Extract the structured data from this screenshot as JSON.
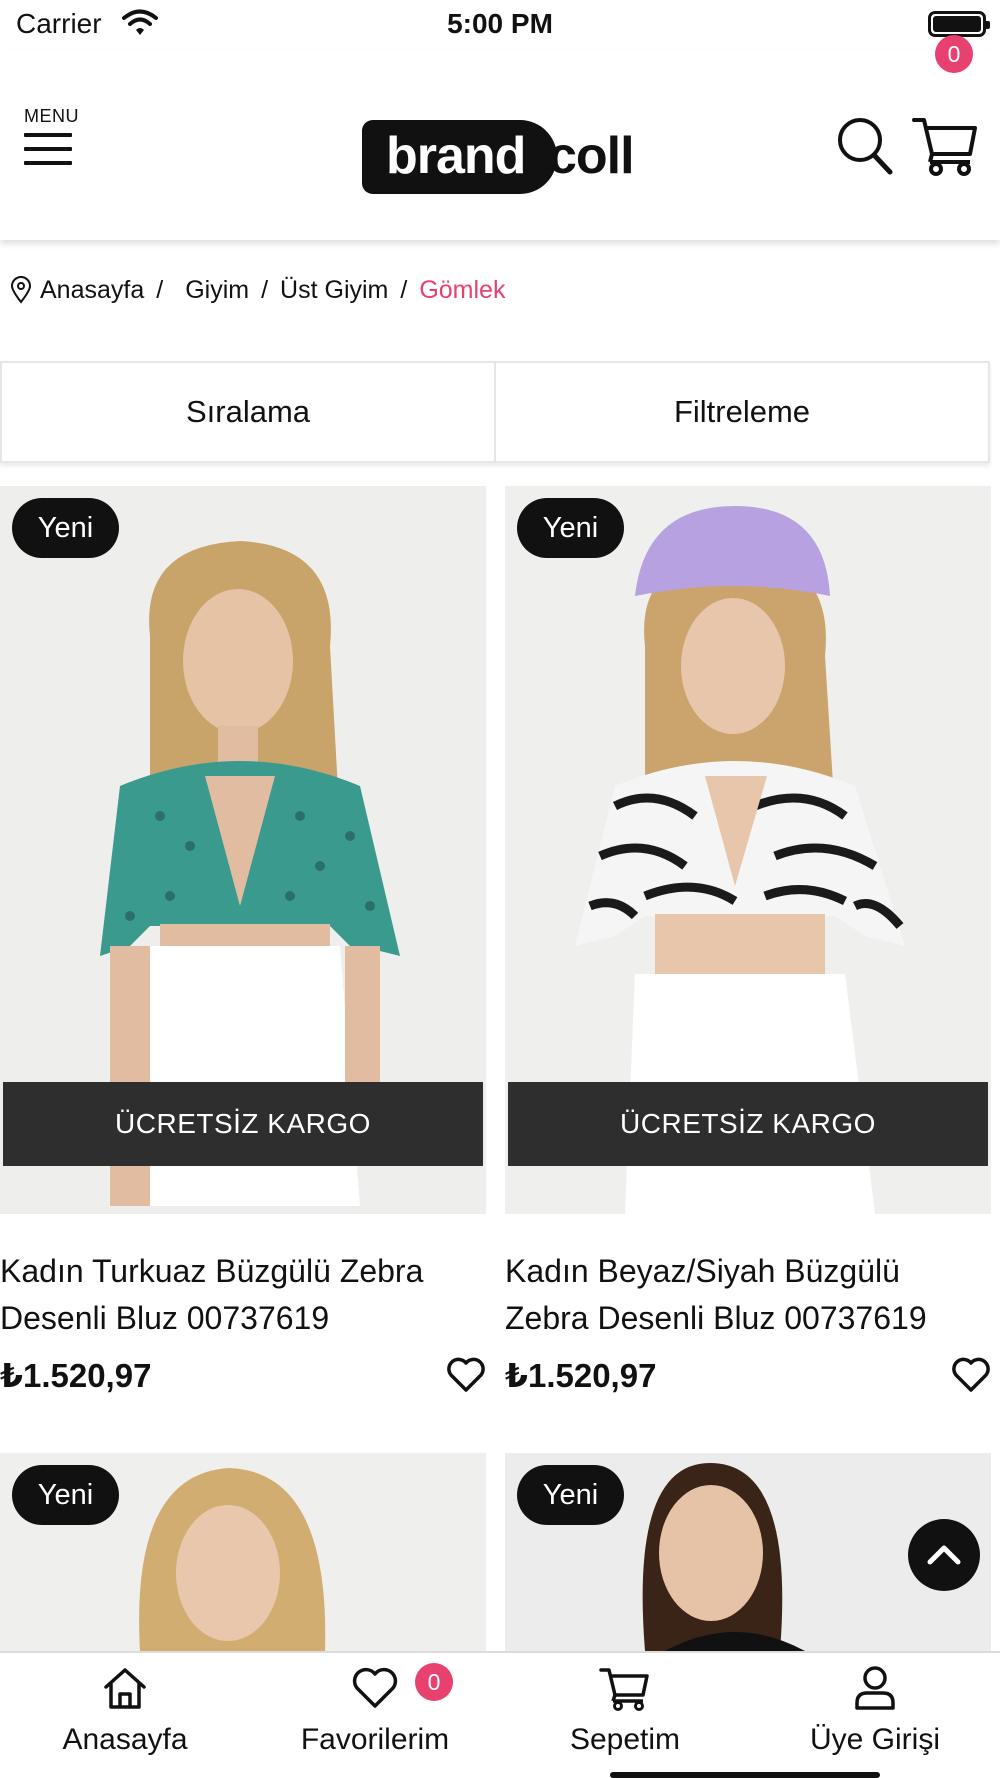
{
  "status_bar": {
    "carrier": "Carrier",
    "time": "5:00 PM"
  },
  "header": {
    "menu_label": "MENU",
    "logo": {
      "part1": "brand",
      "part2": "coll"
    },
    "cart_count": "0"
  },
  "breadcrumb": {
    "items": [
      "Anasayfa",
      "Giyim",
      "Üst Giyim"
    ],
    "separator": "/",
    "current": "Gömlek"
  },
  "toolbar": {
    "sort_label": "Sıralama",
    "filter_label": "Filtreleme"
  },
  "products": [
    {
      "badge": "Yeni",
      "shipping": "ÜCRETSİZ KARGO",
      "name": "Kadın Turkuaz Büzgülü Zebra Desenli Bluz 00737619",
      "price": "₺1.520,97"
    },
    {
      "badge": "Yeni",
      "shipping": "ÜCRETSİZ KARGO",
      "name": "Kadın Beyaz/Siyah Büzgülü Zebra Desenli Bluz 00737619",
      "price": "₺1.520,97"
    },
    {
      "badge": "Yeni"
    },
    {
      "badge": "Yeni"
    }
  ],
  "tabbar": {
    "home": "Anasayfa",
    "favorites": "Favorilerim",
    "favorites_count": "0",
    "cart": "Sepetim",
    "account": "Üye Girişi"
  },
  "colors": {
    "accent": "#e8416f",
    "dark": "#111111",
    "kargo_bg": "#2e2e2e"
  },
  "icons": [
    "wifi-icon",
    "battery-icon",
    "menu-icon",
    "search-icon",
    "cart-icon",
    "location-pin-icon",
    "heart-icon",
    "chevron-up-icon",
    "home-icon",
    "user-icon"
  ]
}
